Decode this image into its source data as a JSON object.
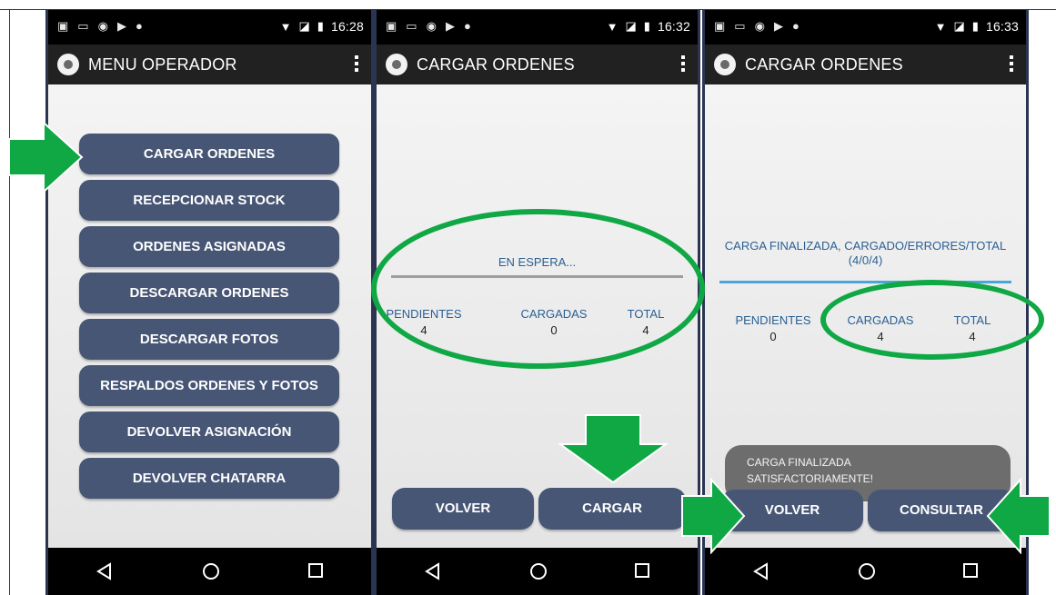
{
  "colors": {
    "phone_frame": "#2b3553",
    "button_bg": "#475675",
    "annotation_green": "#10a845",
    "status_text": "#2a5f93",
    "progress_gray": "#9e9e9e",
    "progress_blue": "#4aa6d9"
  },
  "screens": [
    {
      "time": "16:28",
      "app_title": "MENU OPERADOR",
      "menu": [
        "CARGAR ORDENES",
        "RECEPCIONAR STOCK",
        "ORDENES ASIGNADAS",
        "DESCARGAR ORDENES",
        "DESCARGAR FOTOS",
        "RESPALDOS ORDENES Y FOTOS",
        "DEVOLVER ASIGNACIÓN",
        "DEVOLVER CHATARRA"
      ]
    },
    {
      "time": "16:32",
      "app_title": "CARGAR ORDENES",
      "status": "EN ESPERA...",
      "pendientes_label": "PENDIENTES",
      "pendientes_value": "4",
      "cargadas_label": "CARGADAS",
      "cargadas_value": "0",
      "total_label": "TOTAL",
      "total_value": "4",
      "buttons": [
        "VOLVER",
        "CARGAR"
      ]
    },
    {
      "time": "16:33",
      "app_title": "CARGAR ORDENES",
      "status_line1": "CARGA FINALIZADA, CARGADO/ERRORES/TOTAL",
      "status_line2": "(4/0/4)",
      "pendientes_label": "PENDIENTES",
      "pendientes_value": "0",
      "cargadas_label": "CARGADAS",
      "cargadas_value": "4",
      "total_label": "TOTAL",
      "total_value": "4",
      "toast_line1": "CARGA FINALIZADA",
      "toast_line2": "SATISFACTORIAMENTE!",
      "buttons": [
        "VOLVER",
        "CONSULTAR"
      ]
    }
  ],
  "icons": {
    "status": [
      "screenshot-icon",
      "image-icon",
      "sync-icon",
      "play-store-icon",
      "android-icon",
      "wifi-icon",
      "no-sim-icon",
      "battery-icon"
    ],
    "nav": [
      "back-icon",
      "home-icon",
      "recent-apps-icon"
    ],
    "appbar": [
      "app-logo-icon",
      "overflow-menu-icon"
    ]
  }
}
